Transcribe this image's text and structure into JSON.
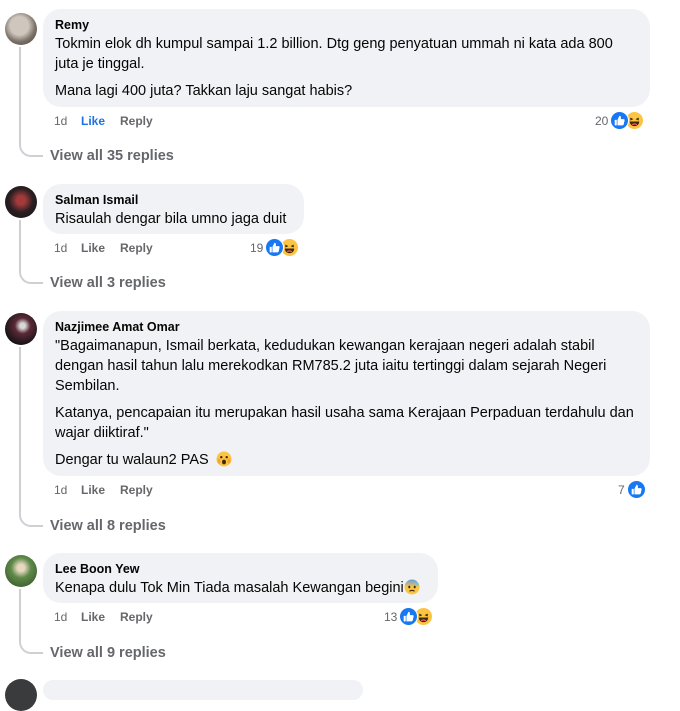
{
  "comments": [
    {
      "author": "Remy",
      "paragraphs": [
        "Tokmin elok dh kumpul sampai 1.2 billion. Dtg geng penyatuan ummah ni kata ada 800 juta je tinggal.",
        "Mana lagi 400 juta? Takkan laju sangat habis?"
      ],
      "time": "1d",
      "like": "Like",
      "reply": "Reply",
      "reaction_count": "20",
      "view_replies": "View all 35 replies"
    },
    {
      "author": "Salman Ismail",
      "paragraphs": [
        "Risaulah dengar bila umno jaga duit"
      ],
      "time": "1d",
      "like": "Like",
      "reply": "Reply",
      "reaction_count": "19",
      "view_replies": "View all 3 replies"
    },
    {
      "author": "Nazjimee Amat Omar",
      "paragraphs": [
        "\"Bagaimanapun, Ismail berkata, kedudukan kewangan kerajaan negeri adalah stabil dengan hasil tahun lalu merekodkan RM785.2 juta iaitu tertinggi dalam sejarah Negeri Sembilan.",
        "Katanya, pencapaian itu merupakan hasil usaha sama Kerajaan Perpaduan terdahulu dan wajar diiktiraf.\"",
        "Dengar tu walaun2 PAS"
      ],
      "time": "1d",
      "like": "Like",
      "reply": "Reply",
      "reaction_count": "7",
      "view_replies": "View all 8 replies"
    },
    {
      "author": "Lee Boon Yew",
      "paragraphs": [
        "Kenapa dulu Tok Min Tiada masalah Kewangan begini"
      ],
      "time": "1d",
      "like": "Like",
      "reply": "Reply",
      "reaction_count": "13",
      "view_replies": "View all 9 replies"
    }
  ],
  "icons": {
    "like_reaction": "thumbs-up-icon",
    "haha_reaction": "laughing-face-icon",
    "shocked_emoji": "shocked-face-emoji",
    "anxious_emoji": "anxious-sweat-face-emoji"
  },
  "colors": {
    "bubble": "#f0f2f5",
    "like_active": "#1b74e4",
    "muted": "#65676b",
    "like_reaction": "#1877f2",
    "haha_reaction": "#fcc443"
  }
}
